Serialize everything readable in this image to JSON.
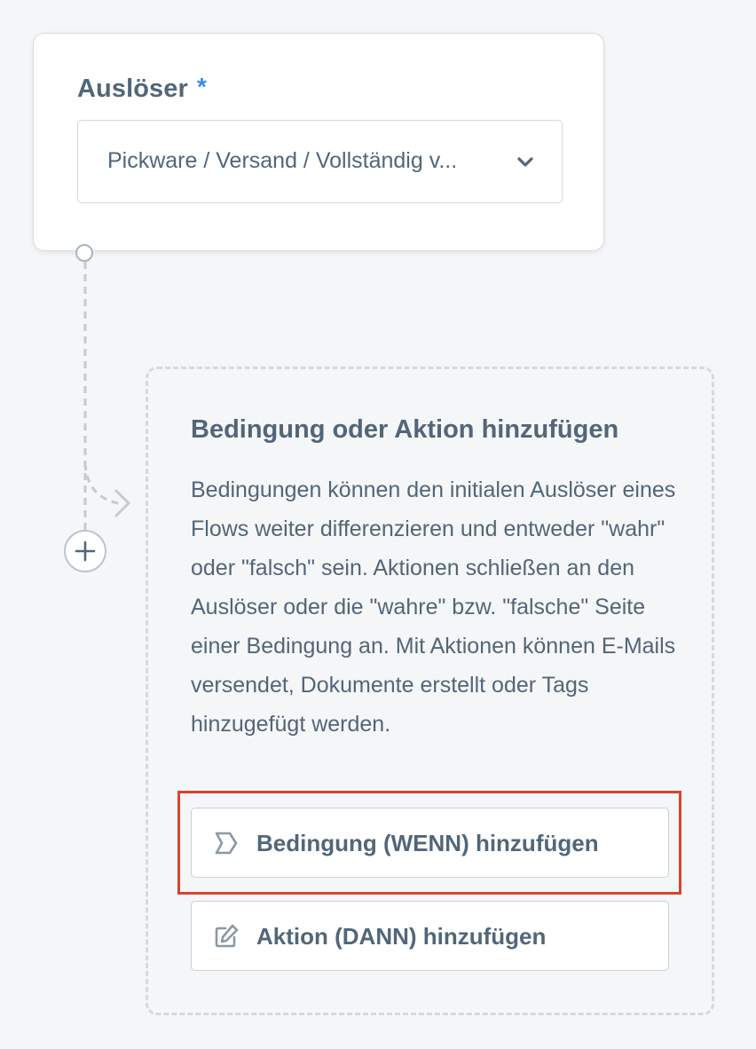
{
  "trigger": {
    "label": "Auslöser",
    "required_mark": "*",
    "selected_value": "Pickware / Versand / Vollständig v..."
  },
  "add_step": {
    "title": "Bedingung oder Aktion hinzufügen",
    "description": "Bedingungen können den initialen Auslöser eines Flows weiter differenzieren und entweder \"wahr\" oder \"falsch\" sein. Aktionen schließen an den Auslöser oder die \"wahre\" bzw. \"falsche\" Seite einer Bedingung an. Mit Aktionen können E-Mails versendet, Dokumente erstellt oder Tags hinzugefügt werden.",
    "condition_button_label": "Bedingung (WENN) hinzufügen",
    "condition_button_icon": "condition-chevron-icon",
    "action_button_label": "Aktion (DANN) hinzufügen",
    "action_button_icon": "edit-icon"
  },
  "colors": {
    "text": "#52667a",
    "required_star": "#3d8ee5",
    "highlight": "#d9432f",
    "panel_border": "#d3d9df",
    "background": "#f5f6f7"
  }
}
